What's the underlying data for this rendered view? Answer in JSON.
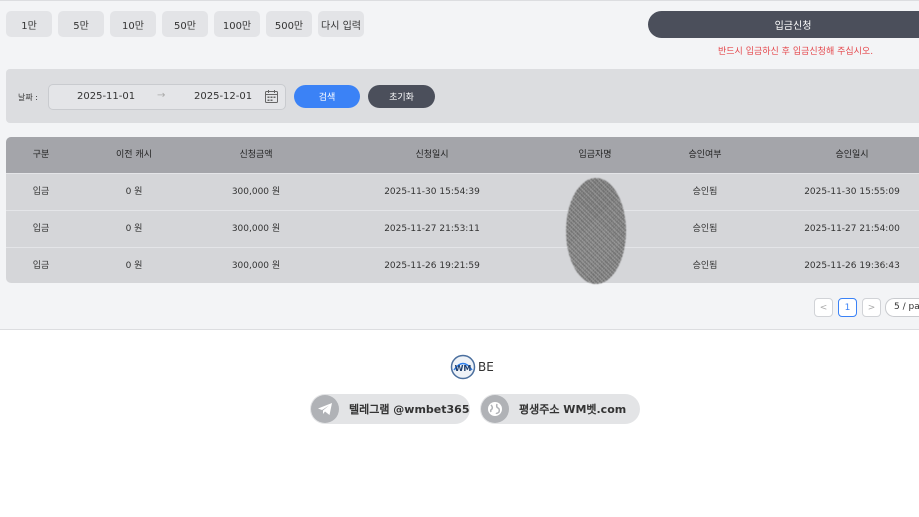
{
  "amount_buttons": [
    "1만",
    "5만",
    "10만",
    "50만",
    "100만",
    "500만",
    "다시 입력"
  ],
  "deposit_request_label": "입금신청",
  "warning_text": "반드시 입금하신 후 입금신청해 주십시오.",
  "filter": {
    "date_label": "날짜 :",
    "start_date": "2025-11-01",
    "end_date": "2025-12-01",
    "search_label": "검색",
    "reset_label": "초기화"
  },
  "table": {
    "headers": [
      "구분",
      "이전 캐시",
      "신청금액",
      "신청일시",
      "입금자명",
      "승인여부",
      "승인일시"
    ],
    "rows": [
      {
        "type": "입금",
        "prev_cash": "0 원",
        "amount": "300,000 원",
        "requested_at": "2025-11-30 15:54:39",
        "depositor": "",
        "status": "승인됨",
        "approved_at": "2025-11-30 15:55:09"
      },
      {
        "type": "입금",
        "prev_cash": "0 원",
        "amount": "300,000 원",
        "requested_at": "2025-11-27 21:53:11",
        "depositor": "",
        "status": "승인됨",
        "approved_at": "2025-11-27 21:54:00"
      },
      {
        "type": "입금",
        "prev_cash": "0 원",
        "amount": "300,000 원",
        "requested_at": "2025-11-26 19:21:59",
        "depositor": "",
        "status": "승인됨",
        "approved_at": "2025-11-26 19:36:43"
      }
    ]
  },
  "pagination": {
    "prev": "<",
    "current_page": "1",
    "next": ">",
    "page_size": "5 / pa"
  },
  "footer": {
    "logo_text": "BE",
    "logo_mark": "WM",
    "telegram_label": "텔레그램 @wmbet365",
    "address_label": "평생주소 WM벳.com"
  },
  "colors": {
    "accent_blue": "#3b82f6",
    "dark_button": "#4b4f5b",
    "warning_red": "#e5484d"
  }
}
